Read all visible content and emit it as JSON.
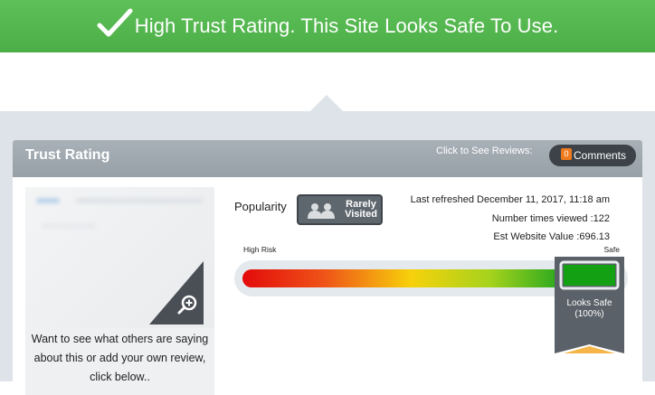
{
  "banner": {
    "text": "High Trust Rating. This Site Looks Safe To Use."
  },
  "panel": {
    "title": "Trust Rating",
    "reviews_prompt": "Click to See Reviews:",
    "comments_button": "Comments",
    "comment_count": "0"
  },
  "thumbnail": {
    "caption": "Want to see what others are saying about this or add your own review, click below.."
  },
  "popularity": {
    "label": "Popularity",
    "badge_line1": "Rarely",
    "badge_line2": "Visited"
  },
  "stats": {
    "last_refreshed": "Last refreshed December 11, 2017, 11:18 am",
    "times_viewed": "Number times viewed :122",
    "website_value": "Est Website Value :696.13"
  },
  "meter": {
    "low_label": "High Risk",
    "high_label": "Safe",
    "result_line1": "Looks Safe",
    "result_line2": "(100%)",
    "level_fraction": 1.0
  },
  "colors": {
    "banner": "#4cae47",
    "header": "#a0a8b0",
    "badge_bg": "#5f676e",
    "comment_badge": "#f07b1e",
    "marker_accent": "#f5b548"
  },
  "icons": [
    "checkmark-icon",
    "zoom-in-icon",
    "people-icon",
    "comment-bubble-icon"
  ]
}
